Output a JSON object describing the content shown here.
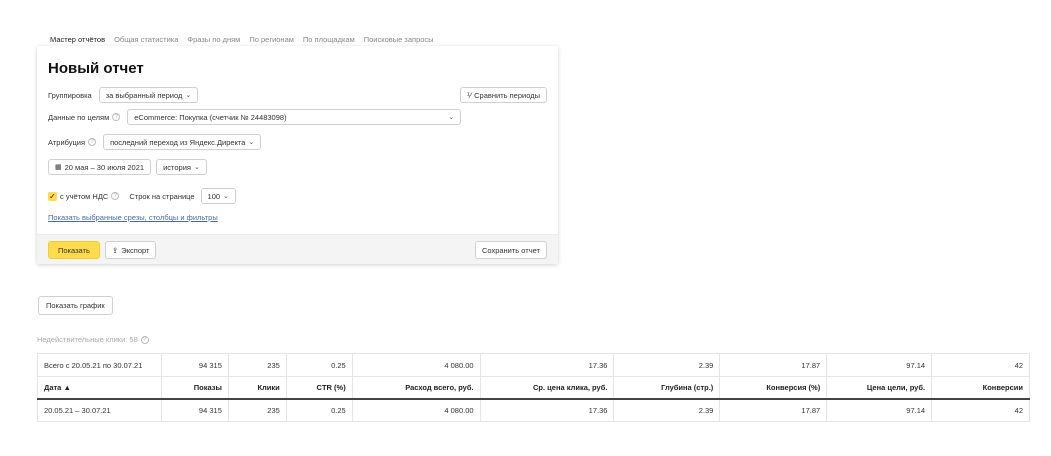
{
  "tabs": [
    {
      "label": "Мастер отчётов",
      "active": true
    },
    {
      "label": "Общая статистика",
      "active": false
    },
    {
      "label": "Фразы по дням",
      "active": false
    },
    {
      "label": "По регионам",
      "active": false
    },
    {
      "label": "По площадкам",
      "active": false
    },
    {
      "label": "Поисковые запросы",
      "active": false
    }
  ],
  "panel": {
    "title": "Новый отчет",
    "grouping_label": "Группировка",
    "grouping_value": "за выбранный период",
    "compare_button": "Сравнить периоды",
    "goals_label": "Данные по целям",
    "goals_value": "eCommerce: Покупка (счетчик № 24483098)",
    "attribution_label": "Атрибуция",
    "attribution_value": "последний переход из Яндекс.Директа",
    "date_range": "20 мая – 30 июля 2021",
    "history_value": "история",
    "vat_label": "с учётом НДС",
    "rows_per_page_label": "Строк на странице",
    "rows_per_page_value": "100",
    "show_filters_link": "Показать выбранные срезы, столбцы и фильтры",
    "show_button": "Показать",
    "export_button": "Экспорт",
    "save_button": "Сохранить отчет"
  },
  "show_chart_button": "Показать график",
  "invalid_clicks": "Недействительные клики: 58",
  "table": {
    "total_row": [
      "Всего с 20.05.21 по 30.07.21",
      "94 315",
      "235",
      "0.25",
      "4 080.00",
      "17.36",
      "2.39",
      "17.87",
      "97.14",
      "42"
    ],
    "headers": [
      "Дата ▲",
      "Показы",
      "Клики",
      "CTR (%)",
      "Расход всего, руб.",
      "Ср. цена клика, руб.",
      "Глубина (стр.)",
      "Конверсия (%)",
      "Цена цели, руб.",
      "Конверсии"
    ],
    "rows": [
      [
        "20.05.21 – 30.07.21",
        "94 315",
        "235",
        "0.25",
        "4 080.00",
        "17.36",
        "2.39",
        "17.87",
        "97.14",
        "42"
      ]
    ]
  },
  "colors": {
    "accent_yellow": "#ffdb4d",
    "link": "#4a6aa8"
  }
}
